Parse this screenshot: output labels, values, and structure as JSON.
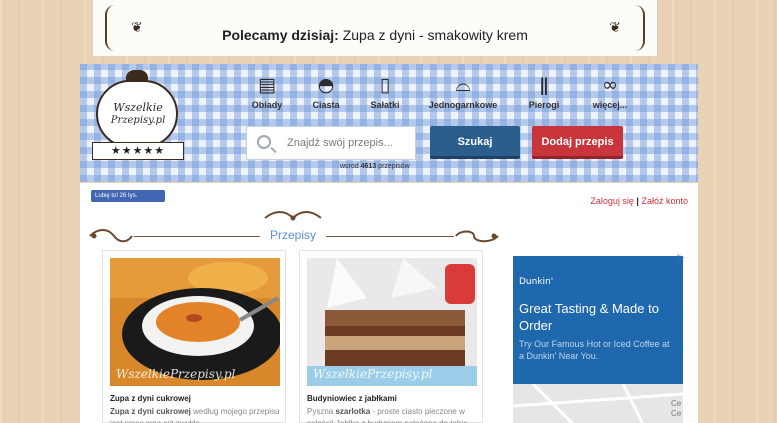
{
  "recommend": {
    "label": "Polecamy dzisiaj:",
    "recipe": "Zupa z dyni - smakowity krem"
  },
  "logo": {
    "line1": "Wszelkie",
    "line2": "Przepisy.pl",
    "stars": "★★★★★"
  },
  "categories": [
    {
      "label": "Obiady",
      "icon": "oven-icon"
    },
    {
      "label": "Ciasta",
      "icon": "cupcake-icon"
    },
    {
      "label": "Sałatki",
      "icon": "bread-icon"
    },
    {
      "label": "Jednogarnkowe",
      "icon": "dish-cover-icon"
    },
    {
      "label": "Pierogi",
      "icon": "fork-knife-icon"
    },
    {
      "label": "więcej...",
      "icon": "bicycle-icon"
    }
  ],
  "search": {
    "placeholder": "Znajdź swój przepis...",
    "button": "Szukaj"
  },
  "add_button": "Dodaj przepis",
  "recipe_count": {
    "prefix": "wsrod",
    "count": "4613",
    "suffix": "przepisów"
  },
  "facebook": {
    "label": "Lubię to! 26 tys."
  },
  "auth": {
    "login": "Zaloguj się",
    "separator": "|",
    "register": "Załóż konto"
  },
  "section_title": "Przepisy",
  "cards": [
    {
      "title": "Zupa z dyni cukrowej",
      "desc_bold": "Zupa z dyni cukrowej",
      "desc": "według mojego przepisu jest nieco inna niż zwykle",
      "watermark": "WszelkiePrzepisy.pl"
    },
    {
      "title": "Budyniowiec z jabłkami",
      "desc_prefix": "Pyszna",
      "desc_bold": "szarlotka",
      "desc": "- proste ciasto pieczone w całości! Jabłka z budyniem nałożona do tobie - ...",
      "watermark": "WszelkiePrzepisy.pl"
    }
  ],
  "ad": {
    "brand": "Dunkin'",
    "headline": "Great Tasting & Made to Order",
    "sub": "Try Our Famous Hot or Iced Coffee at a Dunkin' Near You.",
    "close": "▷",
    "map_labels": [
      "Ce",
      "Ce"
    ]
  },
  "colors": {
    "accent_blue": "#2c5e8d",
    "accent_red": "#c8353b",
    "section_blue": "#5b8fd6",
    "gingham": "#6e96d7"
  }
}
